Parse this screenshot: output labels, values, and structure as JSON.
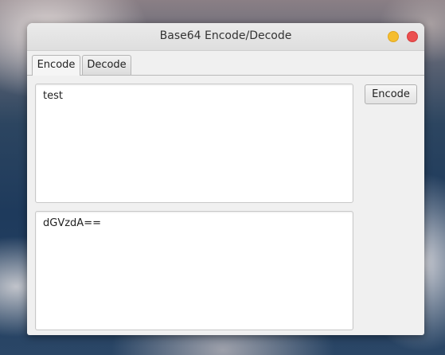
{
  "window": {
    "title": "Base64 Encode/Decode"
  },
  "tabs": [
    {
      "label": "Encode",
      "active": true
    },
    {
      "label": "Decode",
      "active": false
    }
  ],
  "encode_panel": {
    "input_text": "test",
    "output_text": "dGVzdA==",
    "encode_button_label": "Encode"
  },
  "colors": {
    "minimize": "#f5bd2f",
    "close": "#eb4f4f"
  }
}
